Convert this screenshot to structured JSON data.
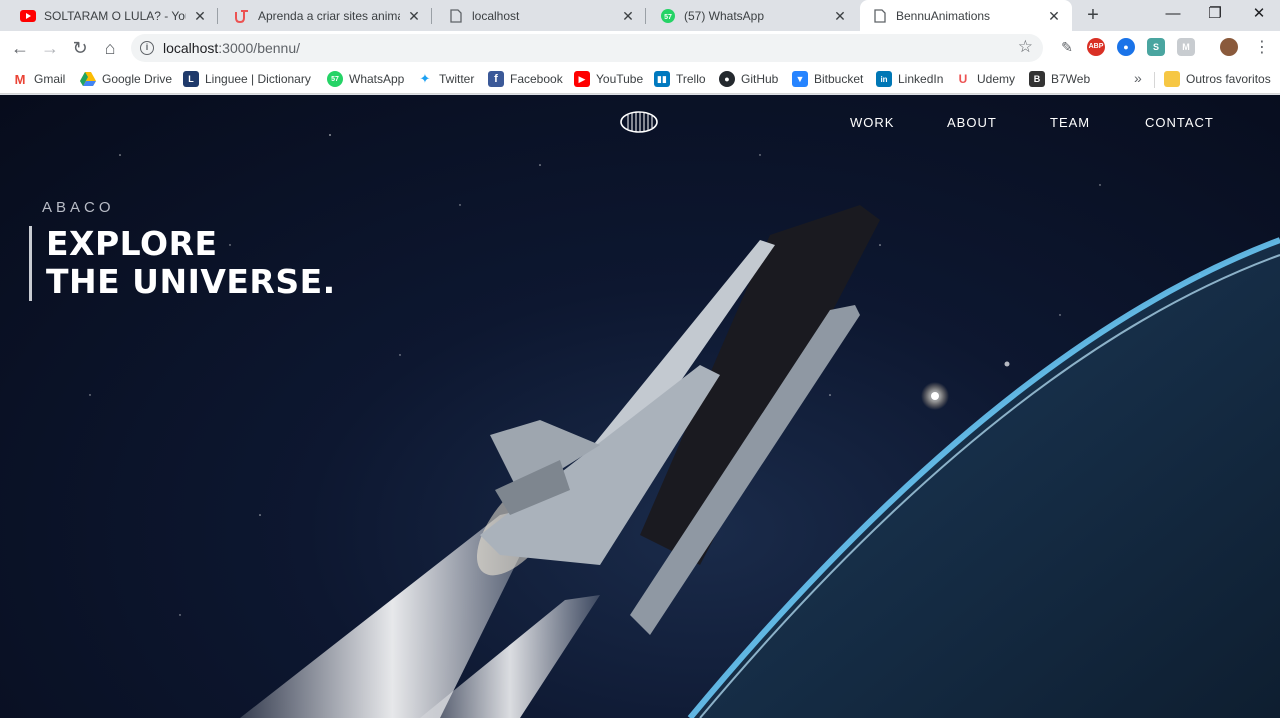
{
  "tabs": [
    {
      "title": "SOLTARAM O LULA? - YouTube",
      "favicon": "youtube-icon",
      "color": "#ff0000"
    },
    {
      "title": "Aprenda a criar sites animados",
      "favicon": "udemy-icon",
      "color": "#ec5252"
    },
    {
      "title": "localhost",
      "favicon": "page-icon",
      "color": "#5f6368"
    },
    {
      "title": "(57) WhatsApp",
      "favicon": "whatsapp-icon",
      "color": "#25d366"
    },
    {
      "title": "BennuAnimations",
      "favicon": "page-icon",
      "color": "#5f6368",
      "active": true
    }
  ],
  "toolbar": {
    "url_host": "localhost",
    "url_path": ":3000/bennu/"
  },
  "bookmarks": [
    {
      "label": "Gmail",
      "icon": "gmail-icon",
      "color": "#ea4335"
    },
    {
      "label": "Google Drive",
      "icon": "google-drive-icon",
      "color": "#1fa463"
    },
    {
      "label": "Linguee | Dictionary f",
      "icon": "linguee-icon",
      "color": "#1f3a6b"
    },
    {
      "label": "WhatsApp",
      "icon": "whatsapp-icon",
      "color": "#25d366"
    },
    {
      "label": "Twitter",
      "icon": "twitter-icon",
      "color": "#1da1f2"
    },
    {
      "label": "Facebook",
      "icon": "facebook-icon",
      "color": "#3b5998"
    },
    {
      "label": "YouTube",
      "icon": "youtube-icon",
      "color": "#ff0000"
    },
    {
      "label": "Trello",
      "icon": "trello-icon",
      "color": "#0079bf"
    },
    {
      "label": "GitHub",
      "icon": "github-icon",
      "color": "#24292e"
    },
    {
      "label": "Bitbucket",
      "icon": "bitbucket-icon",
      "color": "#2684ff"
    },
    {
      "label": "LinkedIn",
      "icon": "linkedin-icon",
      "color": "#0077b5"
    },
    {
      "label": "Udemy",
      "icon": "udemy-icon",
      "color": "#ec5252"
    },
    {
      "label": "B7Web",
      "icon": "b7web-icon",
      "color": "#333333"
    }
  ],
  "bookmarks_more": "»",
  "other_bookmarks": "Outros favoritos",
  "site": {
    "nav": [
      "WORK",
      "ABOUT",
      "TEAM",
      "CONTACT"
    ],
    "eyebrow": "ABACO",
    "hero_line1": "EXPLORE",
    "hero_line2": "THE UNIVERSE."
  }
}
